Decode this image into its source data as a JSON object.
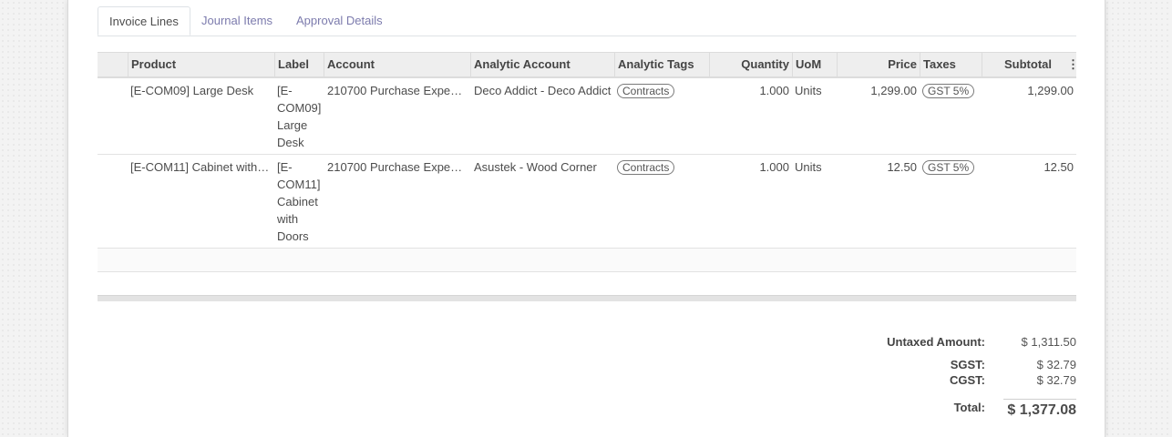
{
  "tabs": [
    "Invoice Lines",
    "Journal Items",
    "Approval Details"
  ],
  "columns": {
    "product": "Product",
    "label": "Label",
    "account": "Account",
    "analytic_account": "Analytic Account",
    "analytic_tags": "Analytic Tags",
    "quantity": "Quantity",
    "uom": "UoM",
    "price": "Price",
    "taxes": "Taxes",
    "subtotal": "Subtotal"
  },
  "lines": [
    {
      "product": "[E-COM09] Large Desk",
      "label": "[E-COM09] Large Desk",
      "account": "210700 Purchase Expe…",
      "analytic_account": "Deco Addict - Deco Addict",
      "analytic_tag": "Contracts",
      "quantity": "1.000",
      "uom": "Units",
      "price": "1,299.00",
      "tax": "GST 5%",
      "subtotal": "1,299.00"
    },
    {
      "product": "[E-COM11] Cabinet with…",
      "label": "[E-COM11] Cabinet with Doors",
      "account": "210700 Purchase Expe…",
      "analytic_account": "Asustek - Wood Corner",
      "analytic_tag": "Contracts",
      "quantity": "1.000",
      "uom": "Units",
      "price": "12.50",
      "tax": "GST 5%",
      "subtotal": "12.50"
    }
  ],
  "totals": {
    "untaxed_label": "Untaxed Amount:",
    "untaxed_value": "$ 1,311.50",
    "sgst_label": "SGST:",
    "sgst_value": "$ 32.79",
    "cgst_label": "CGST:",
    "cgst_value": "$ 32.79",
    "total_label": "Total:",
    "total_value": "$ 1,377.08"
  },
  "icons": {
    "column_menu": "kebab-vertical-icon"
  }
}
